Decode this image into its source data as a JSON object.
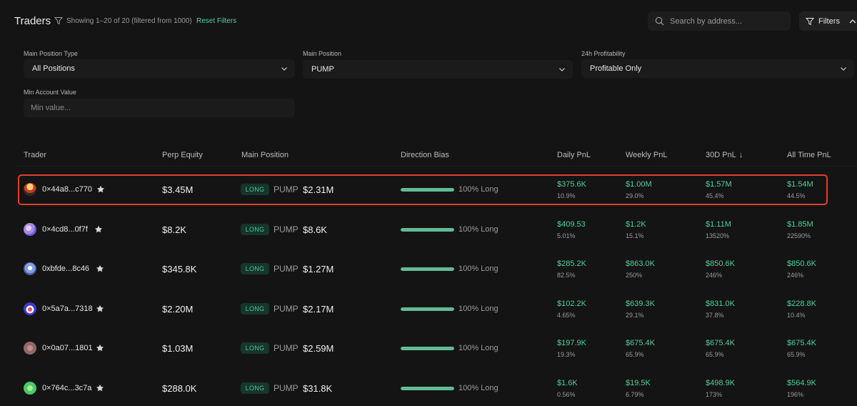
{
  "header": {
    "title": "Traders",
    "showing": "Showing 1–20 of 20 (filtered from 1000)",
    "reset_label": "Reset Filters",
    "search_placeholder": "Search by address...",
    "filters_label": "Filters"
  },
  "filters": {
    "main_position_type": {
      "label": "Main Position Type",
      "value": "All Positions"
    },
    "main_position": {
      "label": "Main Position",
      "value": "PUMP"
    },
    "profitability": {
      "label": "24h Profitability",
      "value": "Profitable Only"
    },
    "min_account_value": {
      "label": "Min Account Value",
      "placeholder": "Min value..."
    }
  },
  "table": {
    "columns": {
      "trader": "Trader",
      "perp_equity": "Perp Equity",
      "main_position": "Main Position",
      "direction_bias": "Direction Bias",
      "daily_pnl": "Daily PnL",
      "weekly_pnl": "Weekly PnL",
      "pnl_30d": "30D PnL",
      "all_time_pnl": "All Time PnL"
    },
    "sorted_column": "30D PnL",
    "sort_direction": "descending",
    "highlighted_row": 0,
    "rows": [
      {
        "trader": "0×44a8...c770",
        "equity": "$3.45M",
        "side": "LONG",
        "coin": "PUMP",
        "position": "$2.31M",
        "bias_fraction": 1.0,
        "bias": "100% Long",
        "daily": "$375.6K",
        "daily_pct": "10.9%",
        "weekly": "$1.00M",
        "weekly_pct": "29.0%",
        "d30": "$1.57M",
        "d30_pct": "45.4%",
        "alltime": "$1.54M",
        "alltime_pct": "44.5%"
      },
      {
        "trader": "0×4cd8...0f7f",
        "equity": "$8.2K",
        "side": "LONG",
        "coin": "PUMP",
        "position": "$8.6K",
        "bias_fraction": 1.0,
        "bias": "100% Long",
        "daily": "$409.53",
        "daily_pct": "5.01%",
        "weekly": "$1.2K",
        "weekly_pct": "15.1%",
        "d30": "$1.11M",
        "d30_pct": "13520%",
        "alltime": "$1.85M",
        "alltime_pct": "22590%"
      },
      {
        "trader": "0xbfde...8c46",
        "equity": "$345.8K",
        "side": "LONG",
        "coin": "PUMP",
        "position": "$1.27M",
        "bias_fraction": 1.0,
        "bias": "100% Long",
        "daily": "$285.2K",
        "daily_pct": "82.5%",
        "weekly": "$863.0K",
        "weekly_pct": "250%",
        "d30": "$850.6K",
        "d30_pct": "246%",
        "alltime": "$850.6K",
        "alltime_pct": "246%"
      },
      {
        "trader": "0×5a7a...7318",
        "equity": "$2.20M",
        "side": "LONG",
        "coin": "PUMP",
        "position": "$2.17M",
        "bias_fraction": 1.0,
        "bias": "100% Long",
        "daily": "$102.2K",
        "daily_pct": "4.65%",
        "weekly": "$639.3K",
        "weekly_pct": "29.1%",
        "d30": "$831.0K",
        "d30_pct": "37.8%",
        "alltime": "$228.8K",
        "alltime_pct": "10.4%"
      },
      {
        "trader": "0×0a07...1801",
        "equity": "$1.03M",
        "side": "LONG",
        "coin": "PUMP",
        "position": "$2.59M",
        "bias_fraction": 1.0,
        "bias": "100% Long",
        "daily": "$197.9K",
        "daily_pct": "19.3%",
        "weekly": "$675.4K",
        "weekly_pct": "65.9%",
        "d30": "$675.4K",
        "d30_pct": "65.9%",
        "alltime": "$675.4K",
        "alltime_pct": "65.9%"
      },
      {
        "trader": "0×764c...3c7a",
        "equity": "$288.0K",
        "side": "LONG",
        "coin": "PUMP",
        "position": "$31.8K",
        "bias_fraction": 1.0,
        "bias": "100% Long",
        "daily": "$1.6K",
        "daily_pct": "0.56%",
        "weekly": "$19.5K",
        "weekly_pct": "6.79%",
        "d30": "$498.9K",
        "d30_pct": "173%",
        "alltime": "$564.9K",
        "alltime_pct": "196%"
      }
    ]
  },
  "colors": {
    "background": "#141414",
    "accent_green": "#4fcf9d",
    "long_badge_bg": "#16352b",
    "highlight_border": "#e0402b"
  }
}
